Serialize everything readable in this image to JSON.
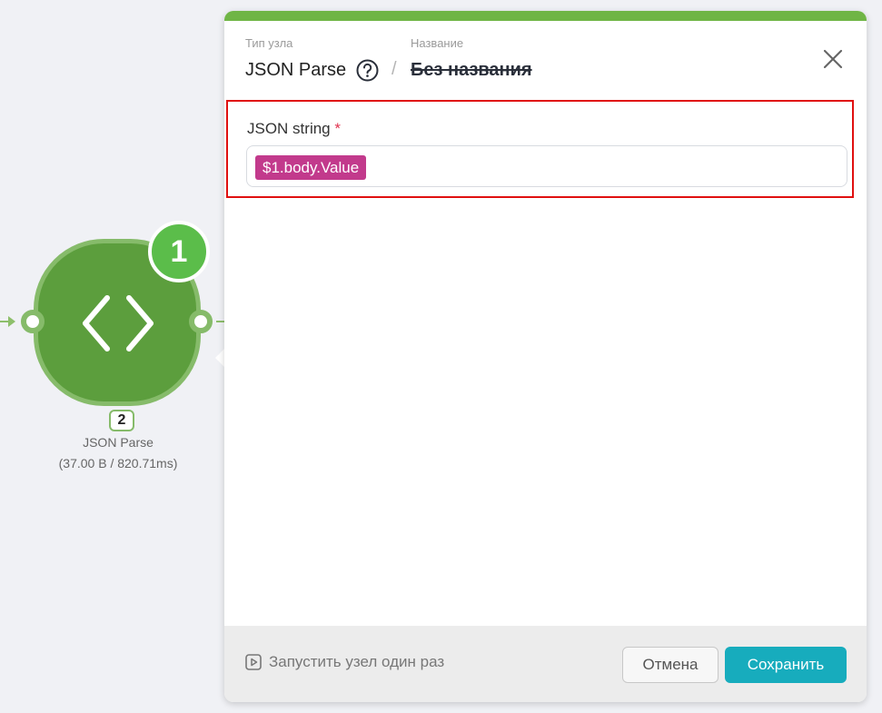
{
  "node": {
    "step_number": "1",
    "index": "2",
    "name": "JSON Parse",
    "stats": "(37.00 B / 820.71ms)",
    "icon": "code-brackets-icon",
    "colors": {
      "node_fill": "#5c9e3d",
      "node_border": "#86bb6a",
      "badge": "#5bbd4a"
    }
  },
  "panel": {
    "type_caption": "Тип узла",
    "type_value": "JSON Parse",
    "name_caption": "Название",
    "name_value": "Без названия",
    "separator": "/",
    "field": {
      "label": "JSON string",
      "required_mark": "*",
      "token": "$1.body.Value"
    },
    "footer": {
      "run_once_label": "Запустить узел один раз",
      "cancel_label": "Отмена",
      "save_label": "Сохранить"
    },
    "colors": {
      "accent_bar": "#6fb545",
      "save_button": "#17acbd",
      "token": "#c23a8c",
      "highlight_border": "#e01010"
    }
  }
}
